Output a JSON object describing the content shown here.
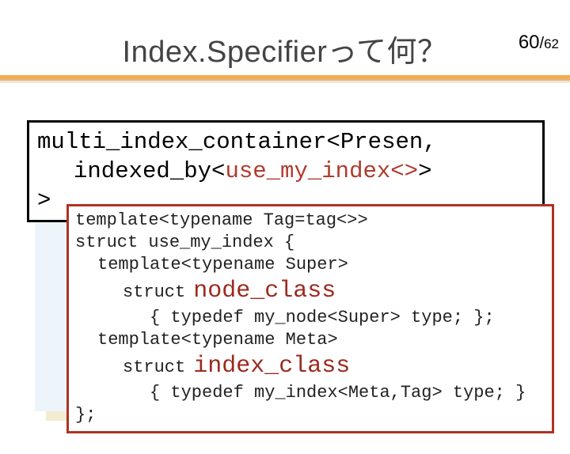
{
  "page": {
    "current": "60",
    "sep": "/",
    "total": "62"
  },
  "title": "Index.Specifierって何？",
  "box1": {
    "line1a": "multi_index_container<Presen,",
    "line2a": "indexed_by<",
    "line2b": "use_my_index<>",
    "line2c": ">",
    "line3": ">"
  },
  "box2": {
    "l1": "template<typename Tag=tag<>>",
    "l2": "struct use_my_index {",
    "l3": "template<typename Super>",
    "l4_kw": "struct",
    "l4_name": "node_class",
    "l5": "{ typedef my_node<Super> type; };",
    "l6": "template<typename Meta>",
    "l7_kw": "struct",
    "l7_name": "index_class",
    "l8": "{ typedef my_index<Meta,Tag> type; }",
    "l9": "};"
  }
}
